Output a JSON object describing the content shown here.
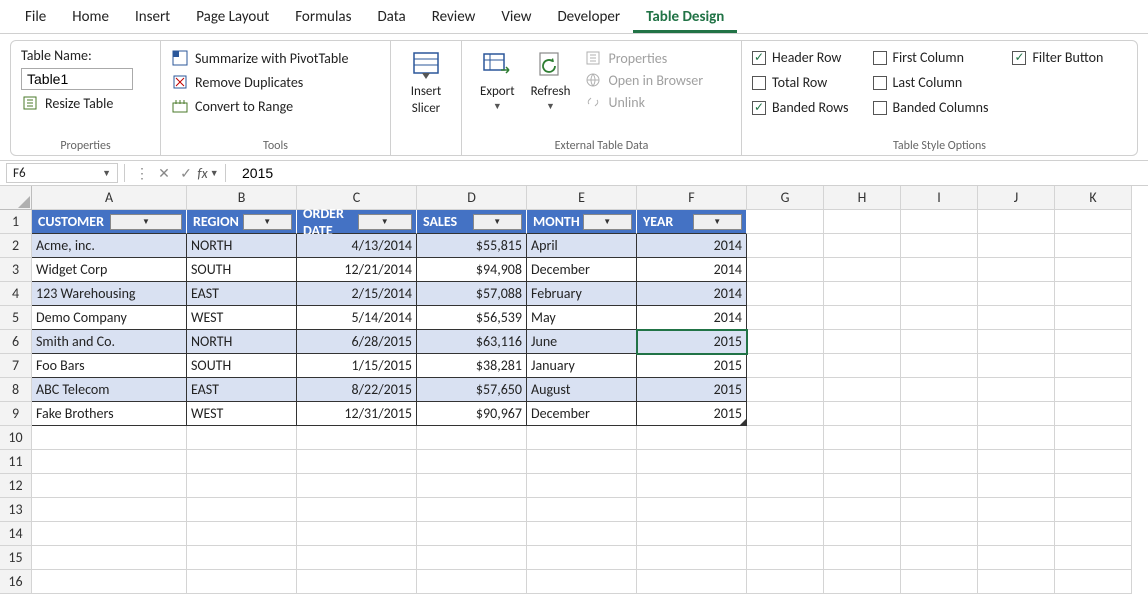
{
  "menu": [
    "File",
    "Home",
    "Insert",
    "Page Layout",
    "Formulas",
    "Data",
    "Review",
    "View",
    "Developer",
    "Table Design"
  ],
  "menu_active": 9,
  "ribbon": {
    "properties": {
      "label": "Properties",
      "table_name_label": "Table Name:",
      "table_name_value": "Table1",
      "resize_label": "Resize Table"
    },
    "tools": {
      "label": "Tools",
      "pivot": "Summarize with PivotTable",
      "dedup": "Remove Duplicates",
      "range": "Convert to Range"
    },
    "slicer": {
      "line1": "Insert",
      "line2": "Slicer"
    },
    "external": {
      "label": "External Table Data",
      "export": "Export",
      "refresh": "Refresh",
      "properties": "Properties",
      "browser": "Open in Browser",
      "unlink": "Unlink"
    },
    "styleopts": {
      "label": "Table Style Options",
      "header_row": "Header Row",
      "total_row": "Total Row",
      "banded_rows": "Banded Rows",
      "first_col": "First Column",
      "last_col": "Last Column",
      "banded_cols": "Banded Columns",
      "filter_btn": "Filter Button",
      "checks": {
        "header_row": true,
        "total_row": false,
        "banded_rows": true,
        "first_col": false,
        "last_col": false,
        "banded_cols": false,
        "filter_btn": true
      }
    }
  },
  "formula_bar": {
    "name_box": "F6",
    "fx_label": "fx",
    "value": "2015"
  },
  "columns": [
    "A",
    "B",
    "C",
    "D",
    "E",
    "F",
    "G",
    "H",
    "I",
    "J",
    "K"
  ],
  "row_count": 16,
  "active_cell": "F6",
  "table": {
    "headers": [
      "CUSTOMER",
      "REGION",
      "ORDER DATE",
      "SALES",
      "MONTH",
      "YEAR"
    ],
    "rows": [
      {
        "customer": "Acme, inc.",
        "region": "NORTH",
        "order_date": "4/13/2014",
        "sales": "$55,815",
        "month": "April",
        "year": "2014"
      },
      {
        "customer": "Widget Corp",
        "region": "SOUTH",
        "order_date": "12/21/2014",
        "sales": "$94,908",
        "month": "December",
        "year": "2014"
      },
      {
        "customer": "123 Warehousing",
        "region": "EAST",
        "order_date": "2/15/2014",
        "sales": "$57,088",
        "month": "February",
        "year": "2014"
      },
      {
        "customer": "Demo Company",
        "region": "WEST",
        "order_date": "5/14/2014",
        "sales": "$56,539",
        "month": "May",
        "year": "2014"
      },
      {
        "customer": "Smith and Co.",
        "region": "NORTH",
        "order_date": "6/28/2015",
        "sales": "$63,116",
        "month": "June",
        "year": "2015"
      },
      {
        "customer": "Foo Bars",
        "region": "SOUTH",
        "order_date": "1/15/2015",
        "sales": "$38,281",
        "month": "January",
        "year": "2015"
      },
      {
        "customer": "ABC Telecom",
        "region": "EAST",
        "order_date": "8/22/2015",
        "sales": "$57,650",
        "month": "August",
        "year": "2015"
      },
      {
        "customer": "Fake Brothers",
        "region": "WEST",
        "order_date": "12/31/2015",
        "sales": "$90,967",
        "month": "December",
        "year": "2015"
      }
    ]
  }
}
